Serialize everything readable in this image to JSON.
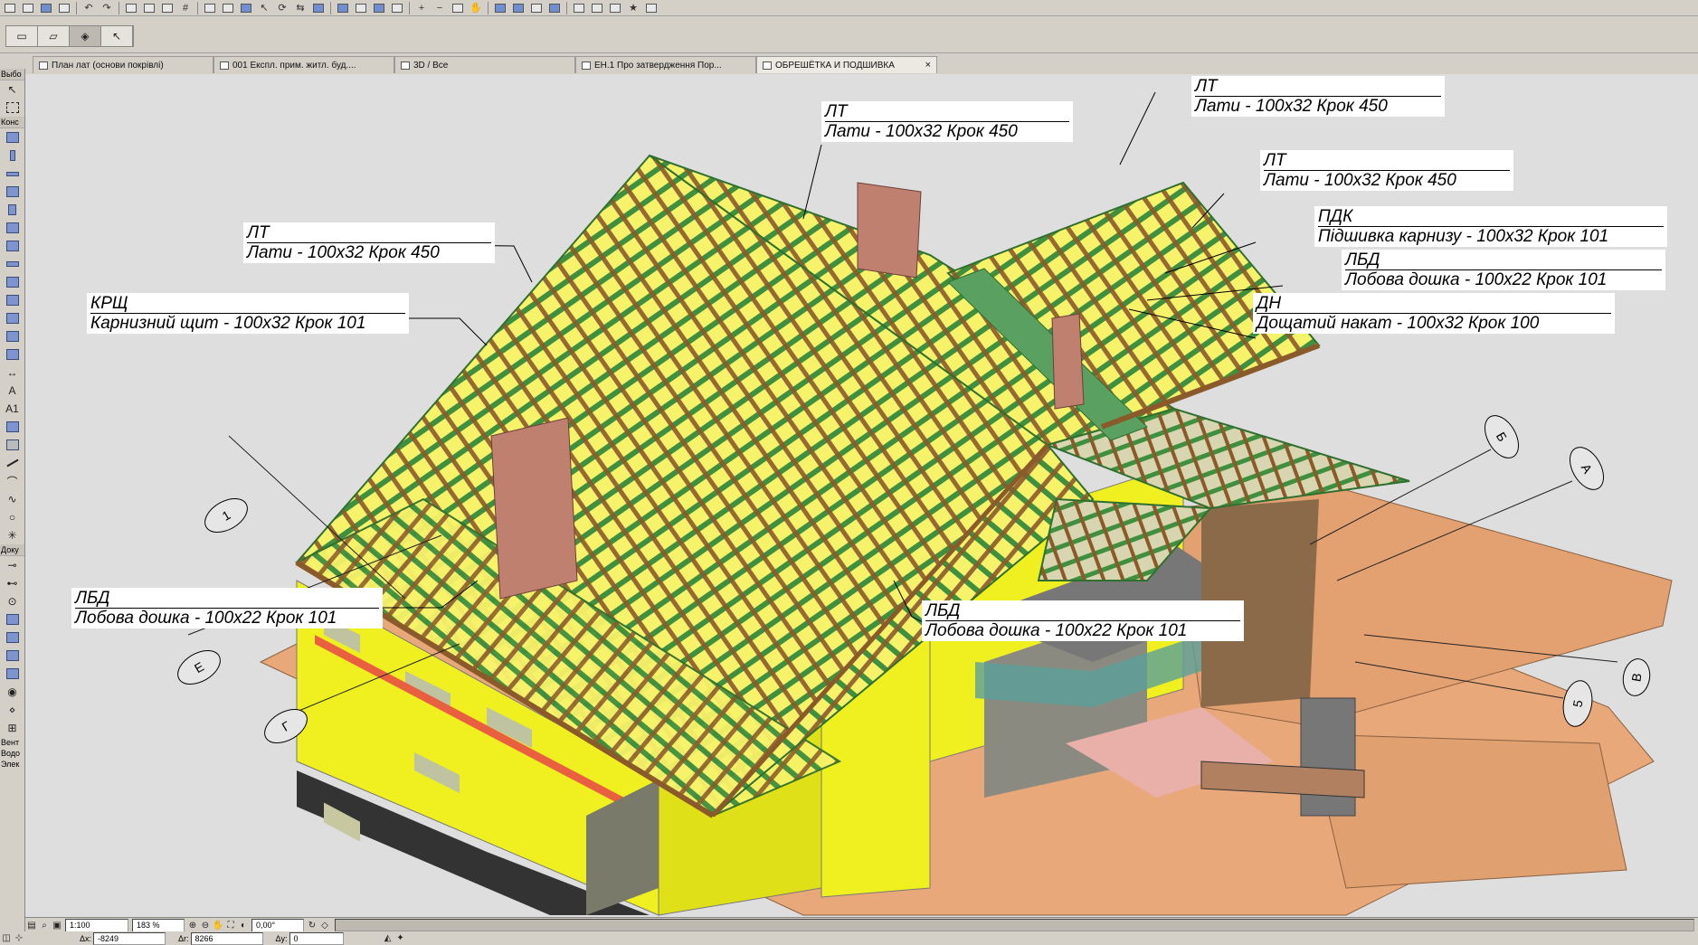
{
  "tabs": [
    {
      "label": "План лат (основи покрівлі)",
      "active": false
    },
    {
      "label": "001 Експл. прим. житл. буд....",
      "active": false
    },
    {
      "label": "3D / Все",
      "active": false
    },
    {
      "label": "ЕН.1 Про затвердження Пор...",
      "active": false
    },
    {
      "label": "ОБРЕШЁТКА И ПОДШИВКА",
      "active": true
    }
  ],
  "toolbox": {
    "section_select": "Выбо",
    "section_construct": "Конс",
    "section_document": "Доку",
    "section_more_1": "Вент",
    "section_more_2": "Водо",
    "section_more_3": "Элек"
  },
  "callouts": [
    {
      "code": "ЛТ",
      "text": "Лати  - 100х32 Крок 450"
    },
    {
      "code": "ЛТ",
      "text": "Лати  - 100х32 Крок 450"
    },
    {
      "code": "ЛТ",
      "text": "Лати  - 100х32 Крок 450"
    },
    {
      "code": "ЛТ",
      "text": "Лати  - 100х32 Крок 450"
    },
    {
      "code": "ПДК",
      "text": "Підшивка карнизу  - 100х32 Крок 101"
    },
    {
      "code": "ЛБД",
      "text": "Лобова дошка  - 100х22 Крок 101"
    },
    {
      "code": "ДН",
      "text": "Дощатий накат  - 100х32 Крок 100"
    },
    {
      "code": "КРЩ",
      "text": "Карнизний щит  - 100х32 Крок 101"
    },
    {
      "code": "ЛБД",
      "text": "Лобова дошка  - 100х22 Крок 101"
    },
    {
      "code": "ЛБД",
      "text": "Лобова дошка  - 100х22 Крок 101"
    }
  ],
  "grid_markers": [
    "1",
    "Е",
    "Г",
    "Б",
    "А",
    "5",
    "В"
  ],
  "status": {
    "scale": "1:100",
    "zoom": "183 %",
    "angle": "0,00°"
  },
  "coords": {
    "dx_label": "Δx:",
    "dx_value": "-8249",
    "dr_label": "Δr:",
    "dr_value": "8266",
    "dy_label": "Δy:",
    "dy_value": "0"
  },
  "colors": {
    "wall": "#f0f020",
    "roof_batten": "#3f8f3f",
    "roof_rafter": "#8b5a2b",
    "chimney": "#c08070",
    "ground": "#e8a87a"
  }
}
